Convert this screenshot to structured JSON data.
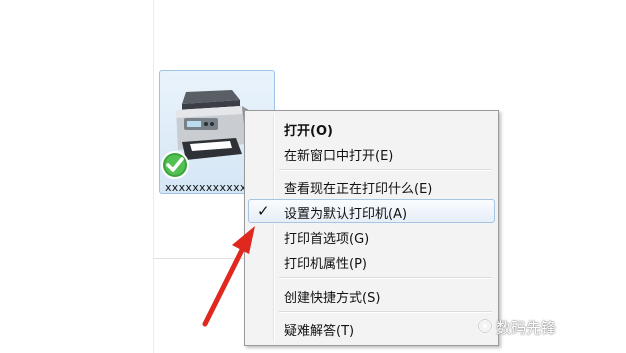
{
  "printer": {
    "label": "xxxxxxxxxxxx",
    "icon": "printer-icon",
    "default_badge_icon": "green-checkmark-icon"
  },
  "context_menu": {
    "items": [
      {
        "label": "打开(O)",
        "bold": true
      },
      {
        "label": "在新窗口中打开(E)"
      },
      {
        "label": "查看现在正在打印什么(E)"
      },
      {
        "label": "设置为默认打印机(A)",
        "checked": true,
        "check_glyph": "✓",
        "highlighted": true
      },
      {
        "label": "打印首选项(G)"
      },
      {
        "label": "打印机属性(P)"
      },
      {
        "label": "创建快捷方式(S)"
      },
      {
        "label": "疑难解答(T)"
      }
    ]
  },
  "annotation": {
    "icon": "red-arrow-icon",
    "color": "#e0281e"
  },
  "watermark": {
    "text": "数码先锋"
  }
}
